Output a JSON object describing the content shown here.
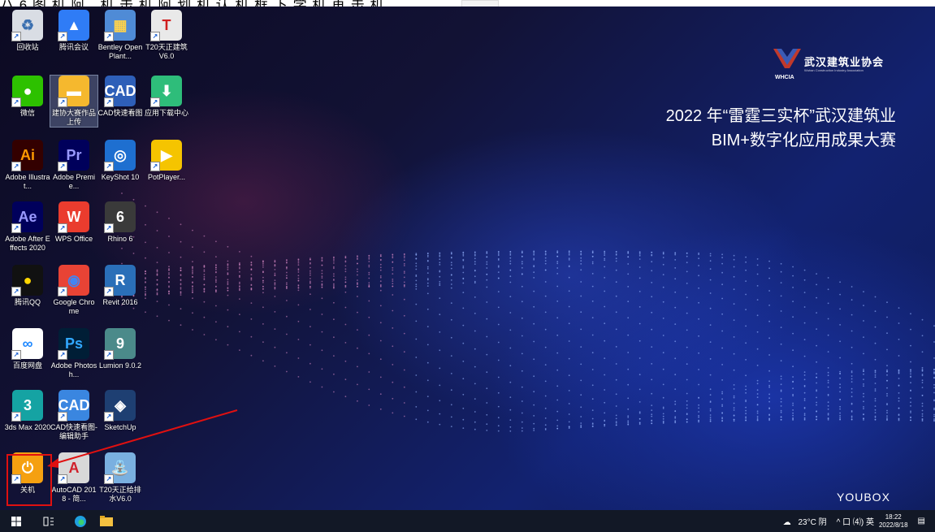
{
  "top_strip": {
    "cut_text": "ハ  6 图 机 阿，机 击 机 阿 划 机 认 机 框 下 学 机 再 击 机"
  },
  "desktop": {
    "icons": [
      {
        "label": "回收站",
        "name": "recycle-bin-icon",
        "glyph": "♻",
        "bg": "#d9dde4",
        "color": "#3a6fb0",
        "selected": false
      },
      {
        "label": "腾讯会议",
        "name": "tencent-meeting-icon",
        "glyph": "▲",
        "bg": "#2f7cf6",
        "color": "#ffffff",
        "selected": false
      },
      {
        "label": "Bentley OpenPlant...",
        "name": "bentley-openplant-icon",
        "glyph": "▦",
        "bg": "#4f8bd6",
        "color": "#ffd24a",
        "selected": false
      },
      {
        "label": "T20天正建筑 V6.0",
        "name": "t20-architecture-icon",
        "glyph": "T",
        "bg": "#e9e9e9",
        "color": "#d01f1f",
        "selected": false
      },
      {
        "label": "微信",
        "name": "wechat-icon",
        "glyph": "●",
        "bg": "#2dc100",
        "color": "#ffffff",
        "selected": false
      },
      {
        "label": "建协大赛作品上传",
        "name": "competition-upload-folder-icon",
        "glyph": "▬",
        "bg": "#f5b82e",
        "color": "#ffffff",
        "selected": true
      },
      {
        "label": "CAD快速看图",
        "name": "cad-viewer-icon",
        "glyph": "CAD",
        "bg": "#2e5fb8",
        "color": "#ffffff",
        "selected": false
      },
      {
        "label": "应用下载中心",
        "name": "app-download-center-icon",
        "glyph": "⬇",
        "bg": "#2ebd7a",
        "color": "#ffffff",
        "selected": false
      },
      {
        "label": "Adobe Illustrat...",
        "name": "adobe-illustrator-icon",
        "glyph": "Ai",
        "bg": "#330000",
        "color": "#ff9a00",
        "selected": false
      },
      {
        "label": "Adobe Premie...",
        "name": "adobe-premiere-icon",
        "glyph": "Pr",
        "bg": "#00005b",
        "color": "#9999ff",
        "selected": false
      },
      {
        "label": "KeyShot 10",
        "name": "keyshot-icon",
        "glyph": "◎",
        "bg": "#1e6fd0",
        "color": "#ffffff",
        "selected": false
      },
      {
        "label": "PotPlayer...",
        "name": "potplayer-icon",
        "glyph": "▶",
        "bg": "#f5c400",
        "color": "#ffffff",
        "selected": false
      },
      {
        "label": "Adobe After Effects 2020",
        "name": "adobe-after-effects-icon",
        "glyph": "Ae",
        "bg": "#00005b",
        "color": "#9999ff",
        "selected": false
      },
      {
        "label": "WPS Office",
        "name": "wps-office-icon",
        "glyph": "W",
        "bg": "#ea3c2e",
        "color": "#ffffff",
        "selected": false
      },
      {
        "label": "Rhino 6",
        "name": "rhino-icon",
        "glyph": "6",
        "bg": "#3a3a3a",
        "color": "#ffffff",
        "selected": false
      },
      {
        "label": "腾讯QQ",
        "name": "tencent-qq-icon",
        "glyph": "●",
        "bg": "#111111",
        "color": "#ffd700",
        "selected": false
      },
      {
        "label": "Google Chrome",
        "name": "google-chrome-icon",
        "glyph": "◉",
        "bg": "#e84335",
        "color": "#4285f4",
        "selected": false
      },
      {
        "label": "Revit 2016",
        "name": "revit-icon",
        "glyph": "R",
        "bg": "#2a6fb8",
        "color": "#ffffff",
        "selected": false
      },
      {
        "label": "百度网盘",
        "name": "baidu-netdisk-icon",
        "glyph": "∞",
        "bg": "#ffffff",
        "color": "#1e88ff",
        "selected": false
      },
      {
        "label": "Adobe Photosh...",
        "name": "adobe-photoshop-icon",
        "glyph": "Ps",
        "bg": "#001e36",
        "color": "#31a8ff",
        "selected": false
      },
      {
        "label": "Lumion 9.0.2",
        "name": "lumion-icon",
        "glyph": "9",
        "bg": "#4b8a8a",
        "color": "#ffffff",
        "selected": false
      },
      {
        "label": "3ds Max 2020",
        "name": "3ds-max-icon",
        "glyph": "3",
        "bg": "#15a3a3",
        "color": "#ffffff",
        "selected": false
      },
      {
        "label": "CAD快速看图-编辑助手",
        "name": "cad-viewer-editor-icon",
        "glyph": "CAD",
        "bg": "#3a86e0",
        "color": "#ffffff",
        "selected": false
      },
      {
        "label": "SketchUp",
        "name": "sketchup-icon",
        "glyph": "◈",
        "bg": "#1e3f72",
        "color": "#ffffff",
        "selected": false
      },
      {
        "label": "关机",
        "name": "shutdown-icon",
        "glyph": "⏻",
        "bg": "#f5a010",
        "color": "#ffffff",
        "selected": false
      },
      {
        "label": "AutoCAD 2018 - 简...",
        "name": "autocad-icon",
        "glyph": "A",
        "bg": "#d8d8d8",
        "color": "#d0202a",
        "selected": false
      },
      {
        "label": "T20天正给排水V6.0",
        "name": "t20-plumbing-icon",
        "glyph": "⛲",
        "bg": "#7ab0e0",
        "color": "#ffffff",
        "selected": false
      }
    ]
  },
  "wallpaper": {
    "logo_name": "武汉建筑业协会",
    "logo_sub": "Wuhan Construction Industry Association",
    "logo_abbr": "WHCIA",
    "title_line1": "2022 年“雷霆三实杯”武汉建筑业",
    "title_line2": "BIM+数字化应用成果大赛",
    "brand": "YOUBOX"
  },
  "taskbar": {
    "weather": "23°C 阴",
    "tray_icons": "^ 口 ⑷) 英",
    "time": "18:22",
    "date": "2022/8/18"
  },
  "colors": {
    "highlight_red": "#e01010",
    "taskbar_bg": "#121826"
  }
}
